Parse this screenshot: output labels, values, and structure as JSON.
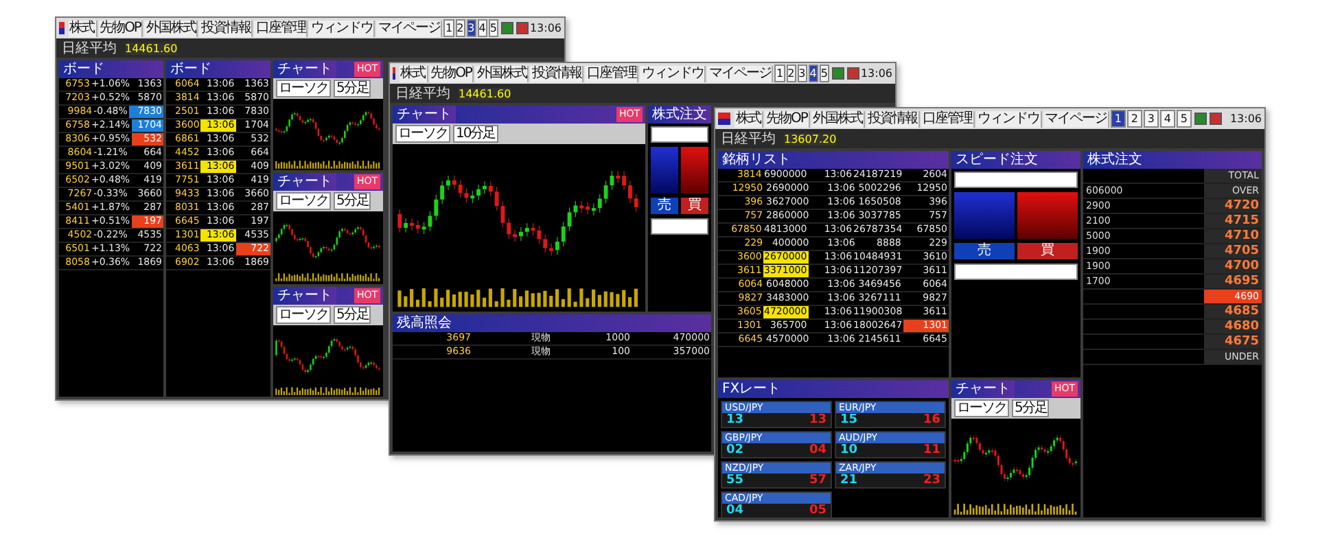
{
  "windows": [
    {
      "menu": [
        "株式",
        "先物OP",
        "外国株式",
        "投資情報",
        "口座管理",
        "ウィンドウ",
        "マイページ"
      ],
      "tabs": [
        {
          "label": "1",
          "selected": false
        },
        {
          "label": "2",
          "selected": false
        },
        {
          "label": "3",
          "selected": true
        },
        {
          "label": "4",
          "selected": false
        },
        {
          "label": "5",
          "selected": false
        }
      ],
      "time": "13:06",
      "ticker": "日経平均",
      "ticker_value": "14461.60",
      "panels": [
        {
          "kind": "list",
          "title": "ボード",
          "rows": [
            {
              "cells": [
                "6753",
                "+1.06%",
                "1363"
              ],
              "kind": "normal"
            },
            {
              "cells": [
                "7203",
                "+0.52%",
                "5870"
              ],
              "kind": "normal"
            },
            {
              "cells": [
                "9984",
                "-0.48%",
                "7830"
              ],
              "kind": "blue"
            },
            {
              "cells": [
                "6758",
                "+2.14%",
                "1704"
              ],
              "kind": "blue"
            },
            {
              "cells": [
                "8306",
                "+0.95%",
                "532"
              ],
              "kind": "down"
            },
            {
              "cells": [
                "8604",
                "-1.21%",
                "664"
              ],
              "kind": "normal"
            },
            {
              "cells": [
                "9501",
                "+3.02%",
                "409"
              ],
              "kind": "normal"
            },
            {
              "cells": [
                "6502",
                "+0.48%",
                "419"
              ],
              "kind": "normal"
            },
            {
              "cells": [
                "7267",
                "-0.33%",
                "3660"
              ],
              "kind": "normal"
            },
            {
              "cells": [
                "5401",
                "+1.87%",
                "287"
              ],
              "kind": "normal"
            },
            {
              "cells": [
                "8411",
                "+0.51%",
                "197"
              ],
              "kind": "down"
            },
            {
              "cells": [
                "4502",
                "-0.22%",
                "4535"
              ],
              "kind": "normal"
            },
            {
              "cells": [
                "6501",
                "+1.13%",
                "722"
              ],
              "kind": "normal"
            },
            {
              "cells": [
                "8058",
                "+0.36%",
                "1869"
              ],
              "kind": "normal"
            }
          ]
        },
        {
          "kind": "list",
          "title": "ボード",
          "rows": [
            {
              "cells": [
                "6064",
                "13:06",
                "1363"
              ],
              "kind": "normal"
            },
            {
              "cells": [
                "3814",
                "13:06",
                "5870"
              ],
              "kind": "normal"
            },
            {
              "cells": [
                "2501",
                "13:06",
                "7830"
              ],
              "kind": "normal"
            },
            {
              "cells": [
                "3600",
                "13:06",
                "1704"
              ],
              "kind": "up"
            },
            {
              "cells": [
                "6861",
                "13:06",
                "532"
              ],
              "kind": "normal"
            },
            {
              "cells": [
                "4452",
                "13:06",
                "664"
              ],
              "kind": "normal"
            },
            {
              "cells": [
                "3611",
                "13:06",
                "409"
              ],
              "kind": "up"
            },
            {
              "cells": [
                "7751",
                "13:06",
                "419"
              ],
              "kind": "normal"
            },
            {
              "cells": [
                "9433",
                "13:06",
                "3660"
              ],
              "kind": "normal"
            },
            {
              "cells": [
                "8031",
                "13:06",
                "287"
              ],
              "kind": "normal"
            },
            {
              "cells": [
                "6645",
                "13:06",
                "197"
              ],
              "kind": "normal"
            },
            {
              "cells": [
                "1301",
                "13:06",
                "4535"
              ],
              "kind": "up"
            },
            {
              "cells": [
                "4063",
                "13:06",
                "722"
              ],
              "kind": "down"
            },
            {
              "cells": [
                "6902",
                "13:06",
                "1869"
              ],
              "kind": "normal"
            }
          ]
        },
        {
          "kind": "chart",
          "title": "チャート",
          "style": "ローソク",
          "period": "5分足",
          "hot": "HOT"
        },
        {
          "kind": "chart",
          "title": "チャート",
          "style": "ローソク",
          "period": "5分足",
          "hot": "HOT"
        },
        {
          "kind": "chart",
          "title": "チャート",
          "style": "ローソク",
          "period": "5分足",
          "hot": "HOT"
        }
      ]
    },
    {
      "menu": [
        "株式",
        "先物OP",
        "外国株式",
        "投資情報",
        "口座管理",
        "ウィンドウ",
        "マイページ"
      ],
      "tabs": [
        {
          "label": "1",
          "selected": false
        },
        {
          "label": "2",
          "selected": false
        },
        {
          "label": "3",
          "selected": false
        },
        {
          "label": "4",
          "selected": true
        },
        {
          "label": "5",
          "selected": false
        }
      ],
      "time": "13:06",
      "ticker": "日経平均",
      "ticker_value": "14461.60",
      "panels": [
        {
          "kind": "chart",
          "title": "チャート",
          "style": "ローソク",
          "period": "10分足",
          "hot": "HOT"
        },
        {
          "kind": "order",
          "title": "株式注文",
          "sell": "売",
          "buy": "買"
        },
        {
          "kind": "positions",
          "title": "残高照会",
          "rows": [
            {
              "cells": [
                "3697",
                "現物",
                "1000",
                "470000"
              ],
              "kind": "normal"
            },
            {
              "cells": [
                "9636",
                "現物",
                "100",
                "357000"
              ],
              "kind": "normal"
            }
          ]
        }
      ]
    },
    {
      "menu": [
        "株式",
        "先物OP",
        "外国株式",
        "投資情報",
        "口座管理",
        "ウィンドウ",
        "マイページ"
      ],
      "tabs": [
        {
          "label": "1",
          "selected": true
        },
        {
          "label": "2",
          "selected": false
        },
        {
          "label": "3",
          "selected": false
        },
        {
          "label": "4",
          "selected": false
        },
        {
          "label": "5",
          "selected": false
        }
      ],
      "time": "13:06",
      "ticker": "日経平均",
      "ticker_value": "13607.20",
      "panels": [
        {
          "kind": "list",
          "title": "銘柄リスト",
          "rows": [
            {
              "cells": [
                "3814",
                "6900000",
                "13:06",
                "24187219",
                "2604"
              ],
              "kind": "normal"
            },
            {
              "cells": [
                "12950",
                "2690000",
                "13:06",
                "5002296",
                "12950"
              ],
              "kind": "normal"
            },
            {
              "cells": [
                "396",
                "3627000",
                "13:06",
                "1650508",
                "396"
              ],
              "kind": "normal"
            },
            {
              "cells": [
                "757",
                "2860000",
                "13:06",
                "3037785",
                "757"
              ],
              "kind": "normal"
            },
            {
              "cells": [
                "67850",
                "4813000",
                "13:06",
                "26787354",
                "67850"
              ],
              "kind": "normal"
            },
            {
              "cells": [
                "229",
                "400000",
                "13:06",
                "8888",
                "229"
              ],
              "kind": "normal"
            },
            {
              "cells": [
                "3600",
                "2670000",
                "13:06",
                "10484931",
                "3610"
              ],
              "kind": "up"
            },
            {
              "cells": [
                "3611",
                "3371000",
                "13:06",
                "11207397",
                "3611"
              ],
              "kind": "up"
            },
            {
              "cells": [
                "6064",
                "6048000",
                "13:06",
                "3469456",
                "6064"
              ],
              "kind": "normal"
            },
            {
              "cells": [
                "9827",
                "3483000",
                "13:06",
                "3267111",
                "9827"
              ],
              "kind": "normal"
            },
            {
              "cells": [
                "3605",
                "4720000",
                "13:06",
                "11900308",
                "3611"
              ],
              "kind": "up"
            },
            {
              "cells": [
                "1301",
                "365700",
                "13:06",
                "18002647",
                "1301"
              ],
              "kind": "down"
            },
            {
              "cells": [
                "6645",
                "4570000",
                "13:06",
                "2145611",
                "6645"
              ],
              "kind": "normal"
            }
          ]
        },
        {
          "kind": "order",
          "title": "スピード注文",
          "sell": "売",
          "buy": "買"
        },
        {
          "kind": "board",
          "title": "株式注文",
          "rows": [
            {
              "qty": "",
              "price": "TOTAL",
              "kind": "label"
            },
            {
              "qty": "606000",
              "price": "OVER",
              "kind": "label"
            },
            {
              "qty": "2900",
              "price": "4720",
              "kind": "ask"
            },
            {
              "qty": "2100",
              "price": "4715",
              "kind": "ask"
            },
            {
              "qty": "5000",
              "price": "4710",
              "kind": "ask"
            },
            {
              "qty": "1900",
              "price": "4705",
              "kind": "ask"
            },
            {
              "qty": "1900",
              "price": "4700",
              "kind": "ask"
            },
            {
              "qty": "1700",
              "price": "4695",
              "kind": "ask"
            },
            {
              "qty": "",
              "price": "4690",
              "kind": "current"
            },
            {
              "qty": "",
              "price": "4685",
              "kind": "bid"
            },
            {
              "qty": "",
              "price": "4680",
              "kind": "bid"
            },
            {
              "qty": "",
              "price": "4675",
              "kind": "bid"
            },
            {
              "qty": "",
              "price": "UNDER",
              "kind": "label"
            }
          ]
        },
        {
          "kind": "fx",
          "title": "FXレート",
          "pairs": [
            {
              "pair": "USD/JPY",
              "bid": "13",
              "ask": "13"
            },
            {
              "pair": "EUR/JPY",
              "bid": "15",
              "ask": "16"
            },
            {
              "pair": "GBP/JPY",
              "bid": "02",
              "ask": "04"
            },
            {
              "pair": "AUD/JPY",
              "bid": "10",
              "ask": "11"
            },
            {
              "pair": "NZD/JPY",
              "bid": "55",
              "ask": "57"
            },
            {
              "pair": "ZAR/JPY",
              "bid": "21",
              "ask": "23"
            },
            {
              "pair": "CAD/JPY",
              "bid": "04",
              "ask": "05"
            }
          ]
        },
        {
          "kind": "chart",
          "title": "チャート",
          "style": "ローソク",
          "period": "5分足",
          "hot": "HOT"
        }
      ]
    }
  ]
}
